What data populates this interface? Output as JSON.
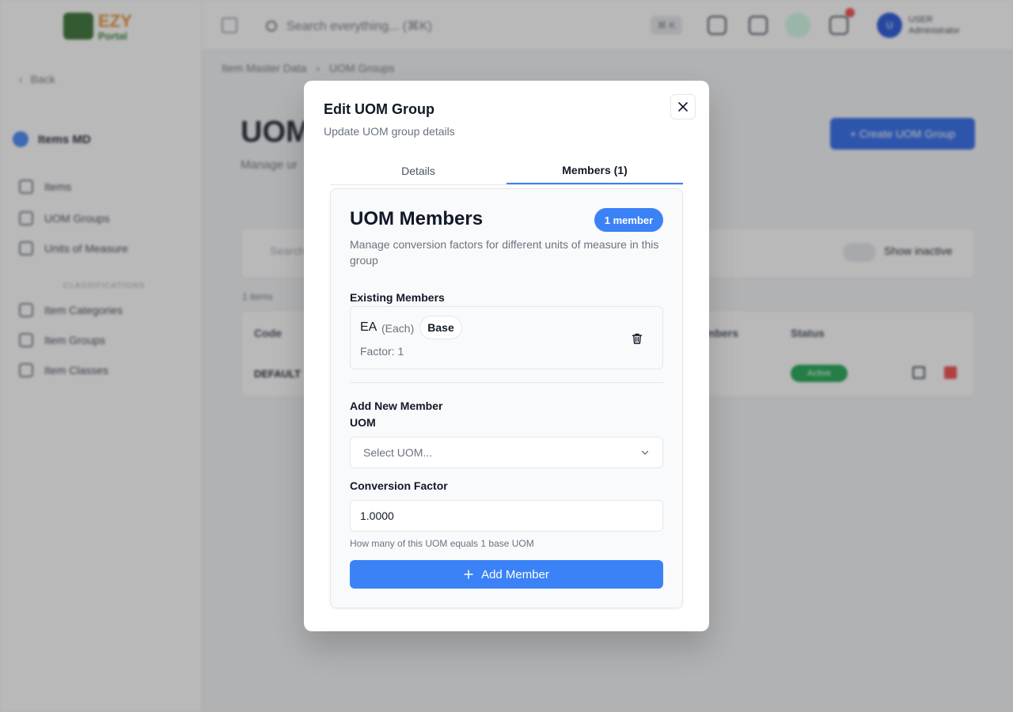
{
  "background": {
    "logo": {
      "line1": "EZY",
      "line2": "Portal"
    },
    "back_label": "Back",
    "module_title": "Items MD",
    "nav": [
      {
        "label": "Items"
      },
      {
        "label": "UOM Groups"
      },
      {
        "label": "Units of Measure"
      },
      {
        "label": "Item Categories"
      },
      {
        "label": "Item Groups"
      },
      {
        "label": "Item Classes"
      }
    ],
    "nav_section": "CLASSIFICATIONS",
    "search_placeholder": "Search everything... (⌘K)",
    "kbd": "⌘ K",
    "user": {
      "initial": "U",
      "name": "USER",
      "role": "Administrator"
    },
    "breadcrumb": {
      "parent": "Item Master Data",
      "current": "UOM Groups"
    },
    "page_title": "UOM",
    "page_subtitle": "Manage ur",
    "create_button": "Create UOM Group",
    "filter_search_placeholder": "Search",
    "show_inactive_label": "Show inactive",
    "items_count": "1 items",
    "table": {
      "headers": {
        "code": "Code",
        "members": "mbers",
        "status": "Status"
      },
      "row": {
        "code": "DEFAULT",
        "status": "Active"
      }
    }
  },
  "modal": {
    "title": "Edit UOM Group",
    "subtitle": "Update UOM group details",
    "tabs": [
      {
        "label": "Details",
        "active": false
      },
      {
        "label": "Members (1)",
        "active": true
      }
    ],
    "members_card": {
      "title": "UOM Members",
      "badge": "1 member",
      "description": "Manage conversion factors for different units of measure in this group",
      "existing_label": "Existing Members",
      "members": [
        {
          "code": "EA",
          "name": "(Each)",
          "base_label": "Base",
          "factor": "Factor: 1"
        }
      ],
      "add_section_label": "Add New Member",
      "uom_label": "UOM",
      "uom_placeholder": "Select UOM...",
      "factor_label": "Conversion Factor",
      "factor_value": "1.0000",
      "factor_hint": "How many of this UOM equals 1 base UOM",
      "add_button": "Add Member"
    }
  },
  "colors": {
    "accent": "#3b82f6",
    "danger": "#ef4444",
    "success": "#16a34a"
  }
}
